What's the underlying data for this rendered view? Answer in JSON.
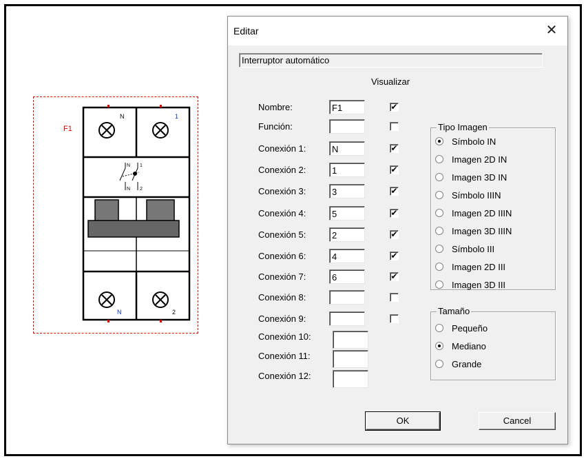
{
  "symbol": {
    "label": "F1",
    "top_terminals": [
      "N",
      "1"
    ],
    "bottom_terminals": [
      "N",
      "2"
    ],
    "switch_labels": [
      "N",
      "1",
      "N",
      "2"
    ]
  },
  "dialog": {
    "title": "Editar",
    "description": "Interruptor automático",
    "visualizar_header": "Visualizar",
    "rows": [
      {
        "label": "Nombre:",
        "value": "F1",
        "show": true
      },
      {
        "label": "Función:",
        "value": "",
        "show": false
      },
      {
        "label": "Conexión 1:",
        "value": "N",
        "show": true
      },
      {
        "label": "Conexión 2:",
        "value": "1",
        "show": true
      },
      {
        "label": "Conexión 3:",
        "value": "3",
        "show": true
      },
      {
        "label": "Conexión 4:",
        "value": "5",
        "show": true
      },
      {
        "label": "Conexión 5:",
        "value": "2",
        "show": true
      },
      {
        "label": "Conexión 6:",
        "value": "4",
        "show": true
      },
      {
        "label": "Conexión 7:",
        "value": "6",
        "show": true
      },
      {
        "label": "Conexión 8:",
        "value": "",
        "show": false
      },
      {
        "label": "Conexión 9:",
        "value": "",
        "show": false
      },
      {
        "label": "Conexión 10:",
        "value": ""
      },
      {
        "label": "Conexión 11:",
        "value": ""
      },
      {
        "label": "Conexión 12:",
        "value": ""
      }
    ],
    "tipo_imagen": {
      "title": "Tipo Imagen",
      "options": [
        "Símbolo IN",
        "Imagen 2D IN",
        "Imagen 3D IN",
        "Símbolo IIIN",
        "Imagen 2D IIIN",
        "Imagen 3D IIIN",
        "Símbolo III",
        "Imagen 2D III",
        "Imagen 3D III"
      ],
      "selected": "Símbolo IN"
    },
    "tamano": {
      "title": "Tamaño",
      "options": [
        "Pequeño",
        "Mediano",
        "Grande"
      ],
      "selected": "Mediano"
    },
    "ok_label": "OK",
    "cancel_label": "Cancel",
    "close_glyph": "✕",
    "check_glyph": "✔"
  }
}
